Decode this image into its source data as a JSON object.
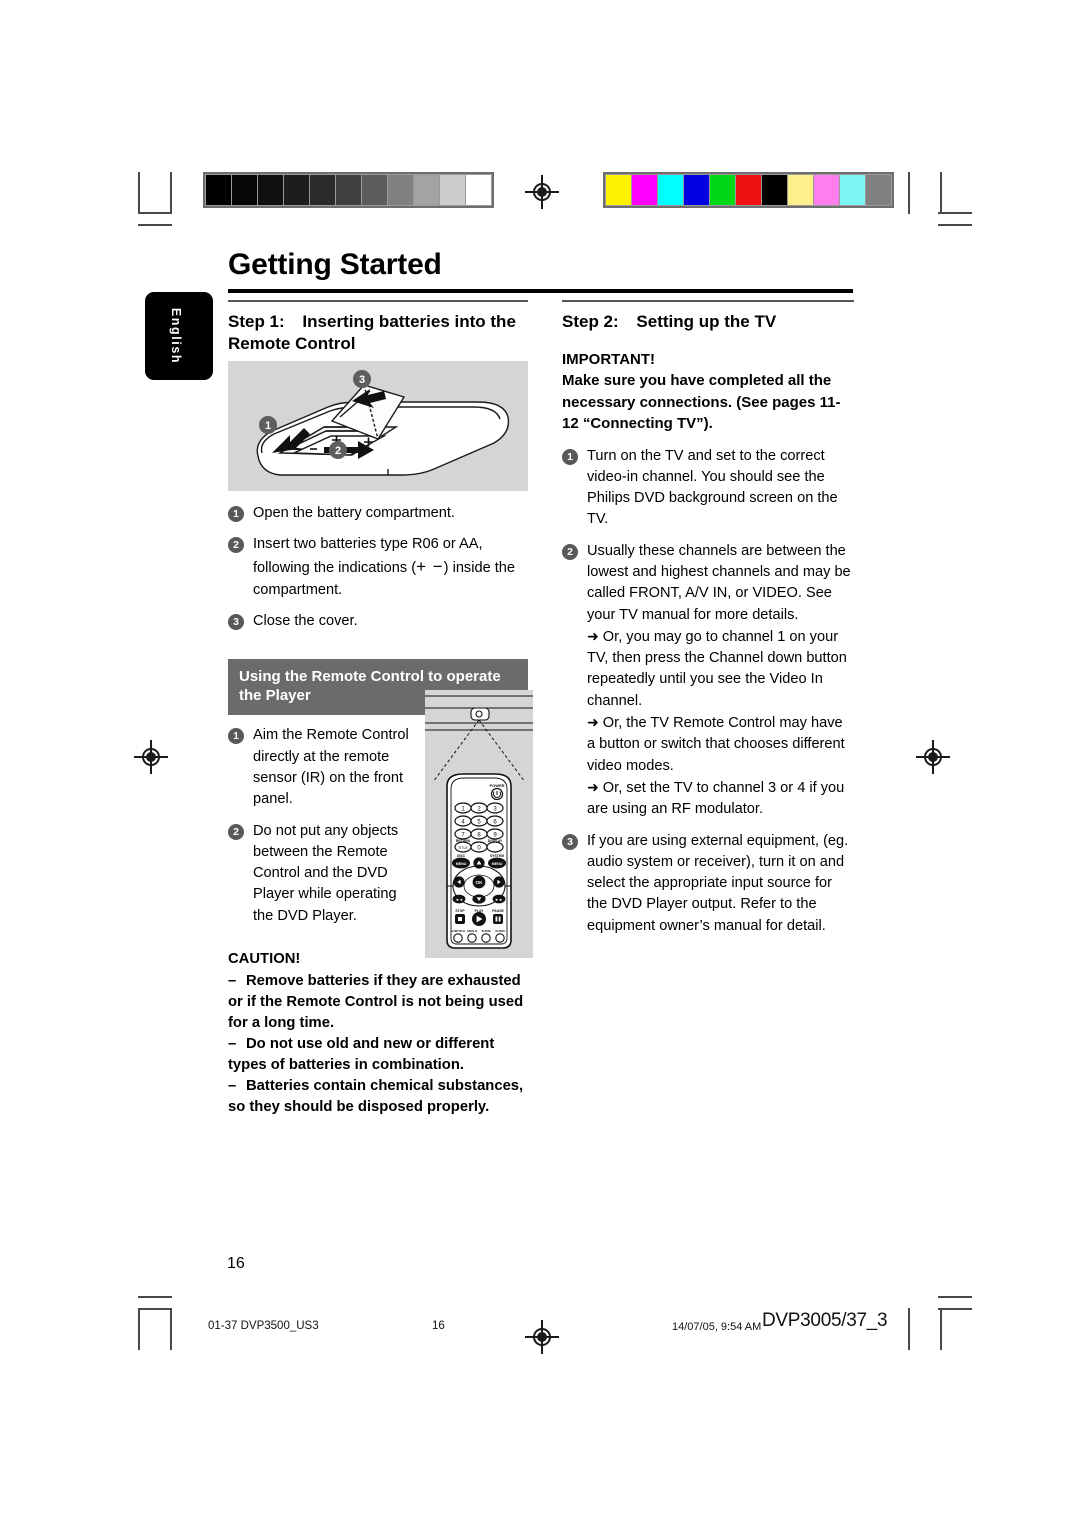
{
  "document": {
    "title": "Getting Started",
    "language_tab": "English",
    "page_number": "16"
  },
  "calibration": {
    "gray_bar": [
      "#000000",
      "#060606",
      "#101010",
      "#1d1d1d",
      "#2b2b2b",
      "#3f3f3f",
      "#5c5c5c",
      "#808080",
      "#a3a3a3",
      "#cccccc",
      "#ffffff"
    ],
    "color_bar": [
      "#fff200",
      "#ff00ff",
      "#00ffff",
      "#0000e0",
      "#00d815",
      "#ee1111",
      "#000000",
      "#fbf08a",
      "#ff7eee",
      "#7cf4f4",
      "#808080"
    ]
  },
  "left_column": {
    "step_label": "Step 1:",
    "step_title": "Inserting batteries into the Remote Control",
    "battery_illustration": {
      "caption_numbers": [
        "1",
        "2",
        "3"
      ],
      "polarity_marks": [
        "+",
        "−"
      ]
    },
    "steps": [
      {
        "num": "1",
        "text": "Open the battery compartment."
      },
      {
        "num": "2",
        "text_before": "Insert two batteries type R06 or AA, following the indications (",
        "symbols": "+ −",
        "text_after": ") inside the compartment."
      },
      {
        "num": "3",
        "text": "Close the cover."
      }
    ],
    "band_title": "Using the Remote Control to operate the Player",
    "remote_steps": [
      {
        "num": "1",
        "text": "Aim the Remote Control directly at the remote sensor (IR) on the front panel."
      },
      {
        "num": "2",
        "text": "Do not put any objects between the Remote Control and the DVD Player while operating the DVD Player."
      }
    ],
    "remote_illustration": {
      "power_label": "POWER",
      "number_keys": [
        "1",
        "2",
        "3",
        "4",
        "5",
        "6",
        "7",
        "8",
        "9",
        "0"
      ],
      "return_label": "RETURN",
      "title_label": "TITLE",
      "display_label": "DISPLAY",
      "disc_label": "DISC",
      "disc_menu_label": "MENU",
      "system_label": "SYSTEM",
      "system_menu_label": "MENU",
      "ok_label": "OK",
      "stop_label": "STOP",
      "play_label": "PLAY",
      "pause_label": "PAUSE",
      "bottom_keys": [
        "SUBTITLE",
        "ANGLE",
        "ZOOM",
        "AUDIO"
      ]
    },
    "caution": {
      "heading": "CAUTION!",
      "items": [
        "Remove batteries if they are exhausted or if the Remote Control is not being used for a long time.",
        "Do not use old and new or different types of batteries in combination.",
        "Batteries contain chemical substances, so they should be disposed properly."
      ],
      "dash": "–"
    }
  },
  "right_column": {
    "step_label": "Step 2:",
    "step_title": "Setting up the TV",
    "important": {
      "heading": "IMPORTANT!",
      "body": "Make sure you have completed all the necessary connections. (See pages 11-12 “Connecting TV”)."
    },
    "steps": [
      {
        "num": "1",
        "text": "Turn on the TV and set to the correct video-in channel. You should see the Philips DVD background screen on the TV.",
        "sub": []
      },
      {
        "num": "2",
        "text": "Usually these channels are between the lowest and highest channels and may be called FRONT, A/V IN, or VIDEO. See your TV manual for more details.",
        "sub": [
          "Or, you may go to channel 1 on your TV, then press the Channel down button repeatedly until you see the Video In channel.",
          "Or, the TV Remote Control may have a button or switch that chooses different video modes.",
          "Or, set the TV to channel 3 or 4 if you are using an RF modulator."
        ]
      },
      {
        "num": "3",
        "text": "If you are using external equipment, (eg. audio system or receiver), turn it on and select the appropriate input source for the DVD Player output. Refer to the equipment owner’s manual for detail.",
        "sub": []
      }
    ],
    "arrow_glyph": "➜"
  },
  "footer": {
    "file_name": "01-37 DVP3500_US3",
    "page": "16",
    "timestamp": "14/07/05, 9:54 AM",
    "model": "DVP3005/37_3"
  }
}
